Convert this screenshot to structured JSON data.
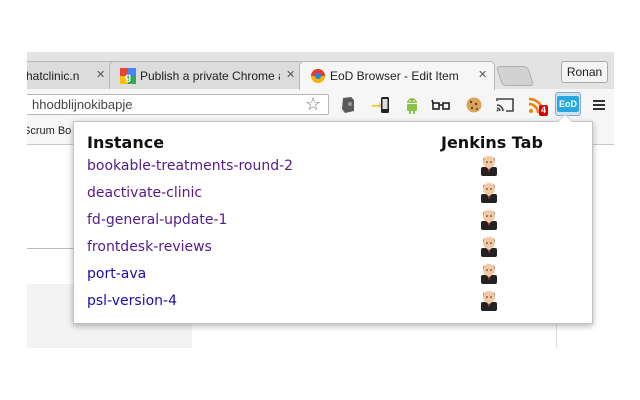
{
  "colors": {
    "visited_link": "#551a8b",
    "unvisited_link": "#1a0dab",
    "tabstrip_bg": "#e3e3e3",
    "toolbar_bg": "#f6f6f6"
  },
  "tabs": [
    {
      "title": "hatclinic.n",
      "favicon": "page-icon",
      "active": false
    },
    {
      "title": "Publish a private Chrome a",
      "favicon": "google-icon",
      "active": false
    },
    {
      "title": "EoD Browser - Edit Item",
      "favicon": "eod-browser-icon",
      "active": true
    }
  ],
  "profile_button": "Ronan",
  "omnibox": {
    "url": "hhodblijnokibapje"
  },
  "toolbar_icons": [
    "bookmark-star-icon",
    "evernote-icon",
    "phone-sync-icon",
    "android-icon",
    "glasses-icon",
    "cookie-icon",
    "cast-icon",
    "rss-icon",
    "eod-extension-icon",
    "menu-icon"
  ],
  "rss_badge": "4",
  "eod_button_label": "EoD",
  "bookmarks_bar": {
    "item": "Scrum Bo"
  },
  "popup": {
    "col_instance": "Instance",
    "col_jenkins": "Jenkins Tab",
    "rows": [
      {
        "name": "bookable-treatments-round-2",
        "visited": true
      },
      {
        "name": "deactivate-clinic",
        "visited": true
      },
      {
        "name": "fd-general-update-1",
        "visited": true
      },
      {
        "name": "frontdesk-reviews",
        "visited": true
      },
      {
        "name": "port-ava",
        "visited": false
      },
      {
        "name": "psl-version-4",
        "visited": false
      }
    ]
  }
}
